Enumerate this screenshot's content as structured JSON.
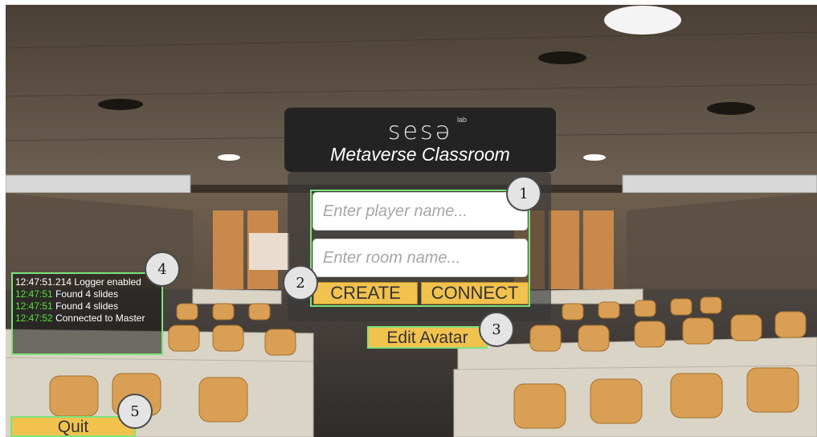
{
  "logo": {
    "brand": "sesə",
    "sub": "lab",
    "title": "Metaverse Classroom"
  },
  "form": {
    "player_placeholder": "Enter player name...",
    "room_placeholder": "Enter room name...",
    "create_label": "CREATE",
    "connect_label": "CONNECT"
  },
  "edit_avatar_label": "Edit Avatar",
  "quit_label": "Quit",
  "log": [
    {
      "time": "12:47:51.214",
      "message": "Logger enabled"
    },
    {
      "time": "12:47:51",
      "message": "Found 4 slides"
    },
    {
      "time": "12:47:51",
      "message": "Found 4 slides"
    },
    {
      "time": "12:47:52",
      "message": "Connected to Master"
    }
  ],
  "badges": {
    "b1": "1",
    "b2": "2",
    "b3": "3",
    "b4": "4",
    "b5": "5"
  },
  "colors": {
    "accent_green": "#7ee27a",
    "button_yellow": "#f2c24f",
    "log_time_green": "#56e03a"
  }
}
